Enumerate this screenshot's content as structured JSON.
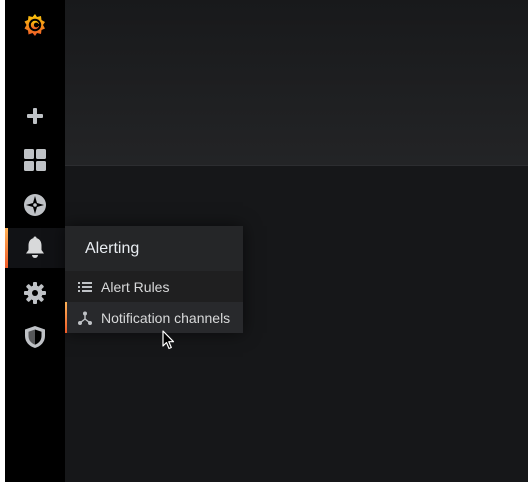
{
  "sidebar": {
    "items": [
      {
        "icon": "grafana-logo-icon"
      },
      {
        "icon": "plus-icon"
      },
      {
        "icon": "dashboards-icon"
      },
      {
        "icon": "explore-compass-icon"
      },
      {
        "icon": "bell-icon",
        "active": true
      },
      {
        "icon": "gear-icon"
      },
      {
        "icon": "shield-icon"
      }
    ]
  },
  "alerting_menu": {
    "title": "Alerting",
    "items": [
      {
        "label": "Alert Rules",
        "icon": "list-icon"
      },
      {
        "label": "Notification channels",
        "icon": "share-nodes-icon",
        "active": true
      }
    ]
  },
  "colors": {
    "sidebar_bg": "#000000",
    "page_bg": "#161719",
    "accent": "#f05a28",
    "accent_light": "#ffb357",
    "text": "#d8d9da"
  }
}
